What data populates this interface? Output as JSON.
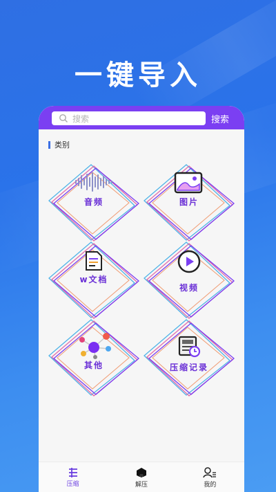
{
  "headline": "一键导入",
  "search": {
    "placeholder": "搜索",
    "button_label": "搜索"
  },
  "category_title": "类别",
  "tiles": [
    {
      "label": "音频",
      "icon": "audio-wave-icon"
    },
    {
      "label": "图片",
      "icon": "image-icon"
    },
    {
      "label": "w文档",
      "icon": "document-icon"
    },
    {
      "label": "视频",
      "icon": "play-icon"
    },
    {
      "label": "其他",
      "icon": "other-bubbles-icon"
    },
    {
      "label": "压缩记录",
      "icon": "compress-record-icon"
    }
  ],
  "tabs": [
    {
      "label": "压缩",
      "icon": "compress-icon",
      "active": true
    },
    {
      "label": "解压",
      "icon": "unzip-icon",
      "active": false
    },
    {
      "label": "我的",
      "icon": "profile-icon",
      "active": false
    }
  ],
  "colors": {
    "accent": "#7b3ff2",
    "label": "#6a2fd6",
    "background": "#2f6fe3"
  }
}
